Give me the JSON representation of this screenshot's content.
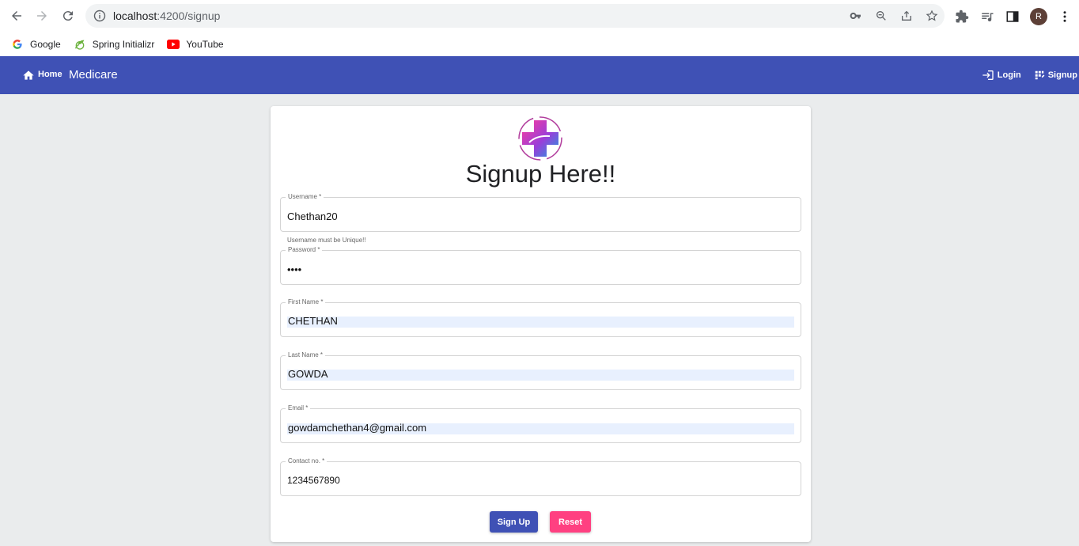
{
  "browser": {
    "url_host": "localhost",
    "url_path": ":4200/signup",
    "avatar_letter": "R",
    "bookmarks": [
      {
        "label": "Google",
        "icon": "google-icon"
      },
      {
        "label": "Spring Initializr",
        "icon": "spring-icon"
      },
      {
        "label": "YouTube",
        "icon": "youtube-icon"
      }
    ]
  },
  "nav": {
    "home": "Home",
    "brand": "Medicare",
    "login": "Login",
    "signup": "Signup"
  },
  "form": {
    "title": "Signup Here!!",
    "username_label": "Username *",
    "username_value": "Chethan20",
    "username_hint": "Username must be Unique!!",
    "password_label": "Password *",
    "password_value": "••••",
    "firstname_label": "First Name *",
    "firstname_value": "CHETHAN",
    "lastname_label": "Last Name *",
    "lastname_value": "GOWDA",
    "email_label": "Email *",
    "email_value": "gowdamchethan4@gmail.com",
    "contact_label": "Contact no. *",
    "contact_value": "1234567890",
    "submit_label": "Sign Up",
    "reset_label": "Reset"
  },
  "colors": {
    "primary": "#3f51b5",
    "accent": "#ff4081",
    "background": "#eaeced"
  }
}
